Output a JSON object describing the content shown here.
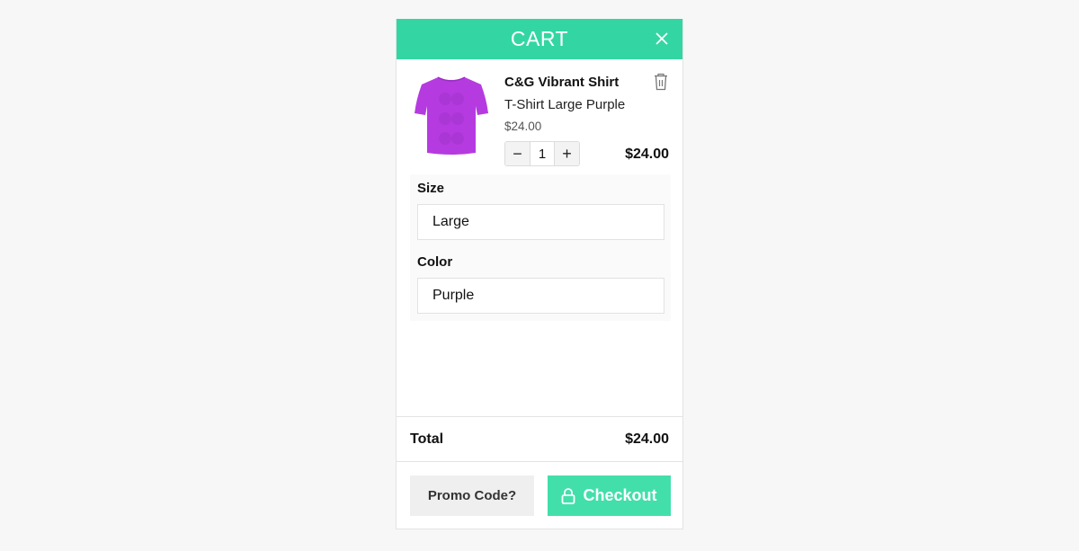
{
  "header": {
    "title": "CART",
    "close_icon": "close-icon"
  },
  "colors": {
    "accent": "#33d6a2",
    "checkout": "#42dfaa",
    "product": "#b53be0"
  },
  "item": {
    "title": "C&G Vibrant Shirt",
    "variant": "T-Shirt Large Purple",
    "unit_price": "$24.00",
    "quantity": "1",
    "decrement_label": "−",
    "increment_label": "+",
    "line_total": "$24.00",
    "thumbnail_icon": "purple-tshirt-image",
    "delete_icon": "trash-icon"
  },
  "options": [
    {
      "label": "Size",
      "value": "Large"
    },
    {
      "label": "Color",
      "value": "Purple"
    }
  ],
  "summary": {
    "total_label": "Total",
    "total_value": "$24.00"
  },
  "actions": {
    "promo_label": "Promo Code?",
    "checkout_label": "Checkout",
    "checkout_icon": "lock-icon"
  }
}
